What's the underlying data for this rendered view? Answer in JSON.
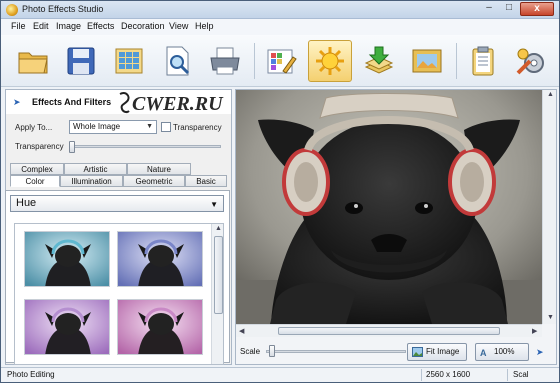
{
  "window": {
    "title": "Photo Effects Studio"
  },
  "menu": [
    "File",
    "Edit",
    "Image",
    "Effects",
    "Decoration",
    "View",
    "Help"
  ],
  "toolbar": {
    "buttons": [
      {
        "icon": "open-folder-icon"
      },
      {
        "icon": "save-floppy-icon"
      },
      {
        "icon": "grid-gallery-icon"
      },
      {
        "icon": "search-document-icon"
      },
      {
        "icon": "printer-icon"
      },
      {
        "icon": "color-palette-edit-icon"
      },
      {
        "icon": "sun-effects-icon",
        "active": true
      },
      {
        "icon": "download-layers-icon"
      },
      {
        "icon": "picture-frame-icon"
      },
      {
        "icon": "clipboard-icon"
      },
      {
        "icon": "tools-gear-icon"
      }
    ]
  },
  "left_panel": {
    "title": "Effects And Filters",
    "watermark": "CWER.RU",
    "apply_to_label": "Apply To...",
    "apply_to_value": "Whole Image",
    "transparency_check_label": "Transparency",
    "transparency_label": "Transparency",
    "tabs_row1": [
      "Complex",
      "Artistic",
      "Nature"
    ],
    "tabs_row2": [
      "Color",
      "Illumination",
      "Geometric",
      "Basic"
    ],
    "selected_tab": "Color",
    "effect_select": "Hue"
  },
  "image_panel": {
    "scale_label": "Scale",
    "fit_image_label": "Fit Image",
    "zoom_label": "100%"
  },
  "status": {
    "mode": "Photo Editing",
    "dimensions": "2560 x 1600",
    "scale": "Scal"
  },
  "colors": {
    "accent": "#c9a13a",
    "thumb_tints": [
      "#6fb3c8",
      "#7a86c9",
      "#b58fd0",
      "#c989c6"
    ]
  }
}
